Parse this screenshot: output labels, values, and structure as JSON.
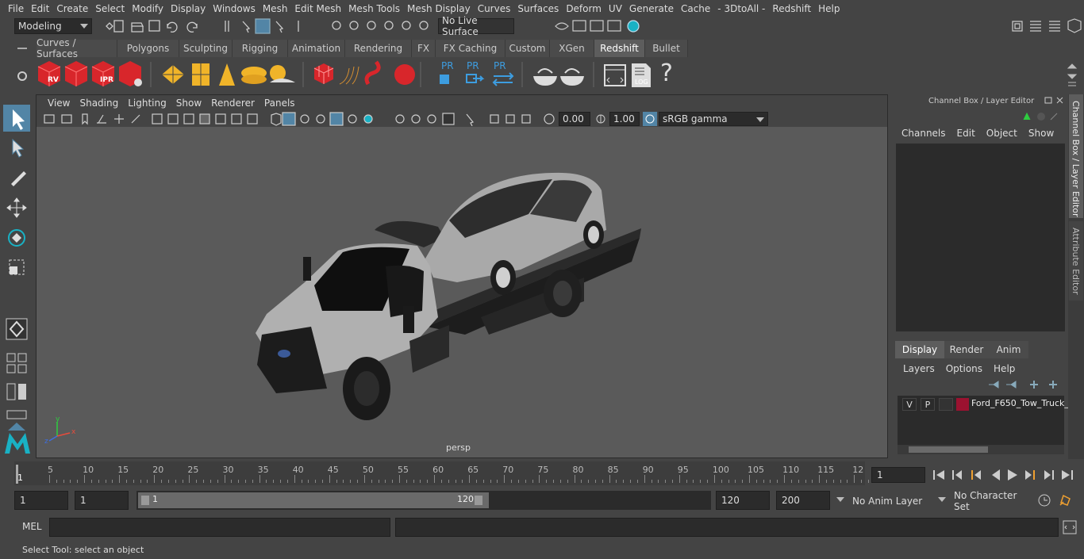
{
  "menubar": [
    "File",
    "Edit",
    "Create",
    "Select",
    "Modify",
    "Display",
    "Windows",
    "Mesh",
    "Edit Mesh",
    "Mesh Tools",
    "Mesh Display",
    "Curves",
    "Surfaces",
    "Deform",
    "UV",
    "Generate",
    "Cache",
    "- 3DtoAll -",
    "Redshift",
    "Help"
  ],
  "status": {
    "mode": "Modeling",
    "live_surface": "No Live Surface"
  },
  "shelf_tabs": [
    "Curves / Surfaces",
    "Polygons",
    "Sculpting",
    "Rigging",
    "Animation",
    "Rendering",
    "FX",
    "FX Caching",
    "Custom",
    "XGen",
    "Redshift",
    "Bullet"
  ],
  "shelf_active": "Redshift",
  "shelf_labels": {
    "rv": "RV",
    "ipr": "IPR",
    "pr": "PR",
    "log": "LOG",
    "help": "?"
  },
  "viewport": {
    "menu": [
      "View",
      "Shading",
      "Lighting",
      "Show",
      "Renderer",
      "Panels"
    ],
    "exposure": "0.00",
    "gamma": "1.00",
    "color_space": "sRGB gamma",
    "camera_label": "persp"
  },
  "channel_box": {
    "title": "Channel Box / Layer Editor",
    "menu": [
      "Channels",
      "Edit",
      "Object",
      "Show"
    ]
  },
  "layer_editor": {
    "tabs": [
      "Display",
      "Render",
      "Anim"
    ],
    "active_tab": "Display",
    "menu": [
      "Layers",
      "Options",
      "Help"
    ],
    "layer": {
      "v": "V",
      "p": "P",
      "name": "Ford_F650_Tow_Truck_",
      "color": "#9b1230"
    }
  },
  "side_tabs": [
    "Channel Box / Layer Editor",
    "Attribute Editor"
  ],
  "timeline": {
    "ticks": [
      "5",
      "10",
      "15",
      "20",
      "25",
      "30",
      "35",
      "40",
      "45",
      "50",
      "55",
      "60",
      "65",
      "70",
      "75",
      "80",
      "85",
      "90",
      "95",
      "100",
      "105",
      "110",
      "115",
      "12"
    ],
    "start_marker": "1",
    "current_frame": "1"
  },
  "range": {
    "start": "1",
    "playback_start": "1",
    "slider_start": "1",
    "slider_end": "120",
    "playback_end": "120",
    "end": "200",
    "anim_layer": "No Anim Layer",
    "character_set": "No Character Set"
  },
  "mel": {
    "label": "MEL"
  },
  "help_line": "Select Tool: select an object",
  "colors": {
    "accent": "#5285a6",
    "maya_teal": "#19b1c4",
    "redshift_red": "#d8262b",
    "active_tab": "#5d5d5d"
  }
}
